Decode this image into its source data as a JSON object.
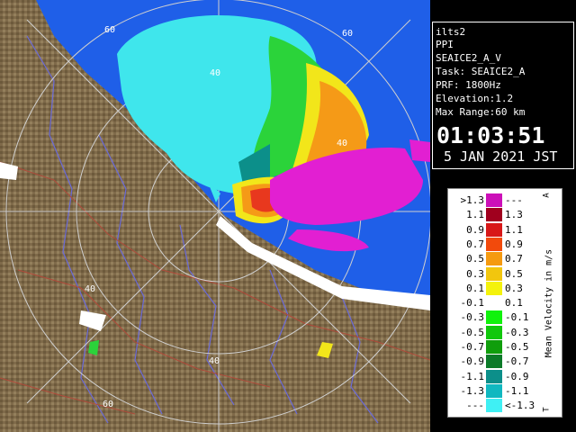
{
  "map": {
    "range_labels": [
      "60",
      "60",
      "40",
      "40",
      "40",
      "40",
      "60"
    ],
    "colors": {
      "sea": "#1f5fe8",
      "land": "#7f6a4a",
      "land_dark": "#5b4a30",
      "river": "#6a6ad8",
      "road": "#b04a3a",
      "ring": "#c8c8c8",
      "echo_cyan": "#3fe6ec",
      "echo_green": "#2bd33a",
      "echo_yellow": "#f2e61a",
      "echo_orange": "#f59a17",
      "echo_red": "#e8381e",
      "echo_magenta": "#e21fd2",
      "echo_white": "#ffffff"
    }
  },
  "info": {
    "site": "ilts2",
    "scan_type": "PPI",
    "product": "SEAICE2_A_V",
    "task": "Task: SEAICE2_A",
    "prf": "PRF: 1800Hz",
    "elevation": "Elevation:1.2",
    "max_range": "Max Range:60 km",
    "time": "01:03:51",
    "date": "5 JAN 2021 JST"
  },
  "legend": {
    "title": "Mean Velocity in m/s",
    "top_mark": "A",
    "bottom_mark": "T",
    "rows": [
      {
        "left": ">1.3",
        "right": "---",
        "color": "#cc10b8"
      },
      {
        "left": "1.1",
        "right": "1.3",
        "color": "#a0001e"
      },
      {
        "left": "0.9",
        "right": "1.1",
        "color": "#d81818"
      },
      {
        "left": "0.7",
        "right": "0.9",
        "color": "#f24a0c"
      },
      {
        "left": "0.5",
        "right": "0.7",
        "color": "#f59a10"
      },
      {
        "left": "0.3",
        "right": "0.5",
        "color": "#f2c60e"
      },
      {
        "left": "0.1",
        "right": "0.3",
        "color": "#f4f20c"
      },
      {
        "left": "-0.1",
        "right": "0.1",
        "color": "#ffffff"
      },
      {
        "left": "-0.3",
        "right": "-0.1",
        "color": "#10f20c"
      },
      {
        "left": "-0.5",
        "right": "-0.3",
        "color": "#10c80c"
      },
      {
        "left": "-0.7",
        "right": "-0.5",
        "color": "#109e0c"
      },
      {
        "left": "-0.9",
        "right": "-0.7",
        "color": "#0c7a28"
      },
      {
        "left": "-1.1",
        "right": "-0.9",
        "color": "#0c8f8a"
      },
      {
        "left": "-1.3",
        "right": "-1.1",
        "color": "#10b8c0"
      },
      {
        "left": "---",
        "right": "<-1.3",
        "color": "#3ff0f4"
      }
    ]
  }
}
